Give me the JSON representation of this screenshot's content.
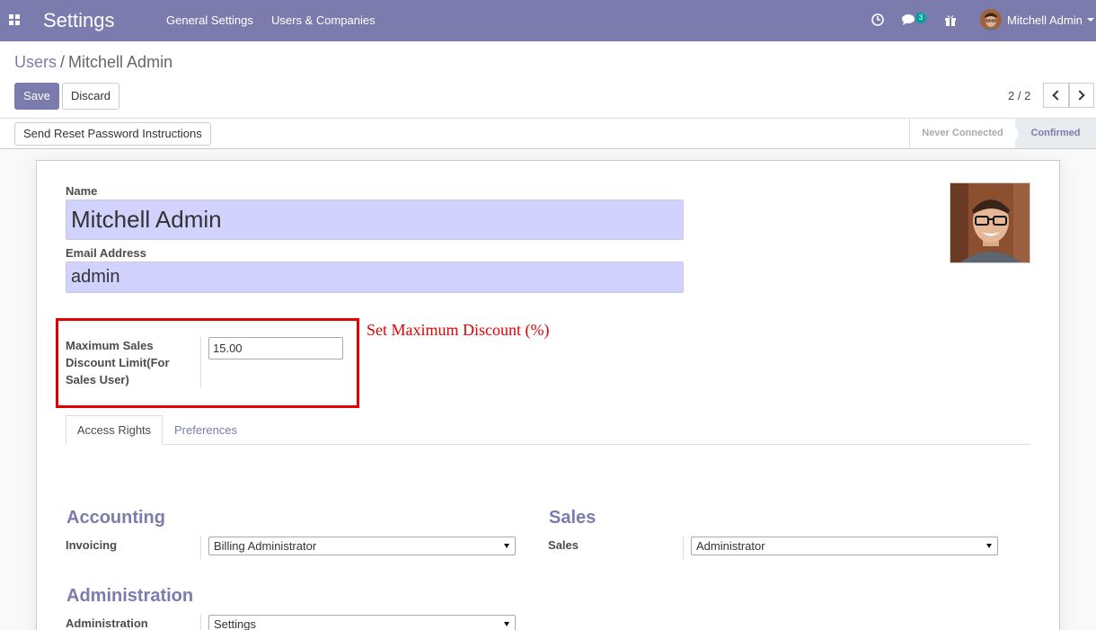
{
  "navbar": {
    "brand": "Settings",
    "menu": [
      "General Settings",
      "Users & Companies"
    ],
    "chat_badge": "3",
    "user_name": "Mitchell Admin"
  },
  "breadcrumb": {
    "parent": "Users",
    "separator": "/",
    "current": "Mitchell Admin"
  },
  "buttons": {
    "save": "Save",
    "discard": "Discard",
    "reset_password": "Send Reset Password Instructions"
  },
  "pager": {
    "value": "2 / 2"
  },
  "statusbar": {
    "stages": [
      "Never Connected",
      "Confirmed"
    ],
    "active_stage": "Confirmed"
  },
  "form": {
    "name_label": "Name",
    "name_value": "Mitchell Admin",
    "email_label": "Email Address",
    "email_value": "admin",
    "discount_label": "Maximum Sales Discount Limit(For Sales User)",
    "discount_value": "15.00",
    "annotation": "Set Maximum Discount (%)"
  },
  "tabs": [
    "Access Rights",
    "Preferences"
  ],
  "groups": {
    "accounting": {
      "title": "Accounting",
      "field_label": "Invoicing",
      "value": "Billing Administrator"
    },
    "sales": {
      "title": "Sales",
      "field_label": "Sales",
      "value": "Administrator"
    },
    "administration": {
      "title": "Administration",
      "field_label": "Administration",
      "value": "Settings"
    }
  },
  "colors": {
    "brand": "#7c7bad",
    "required_field": "#d2d2ff",
    "annotation_red": "#e30000"
  }
}
